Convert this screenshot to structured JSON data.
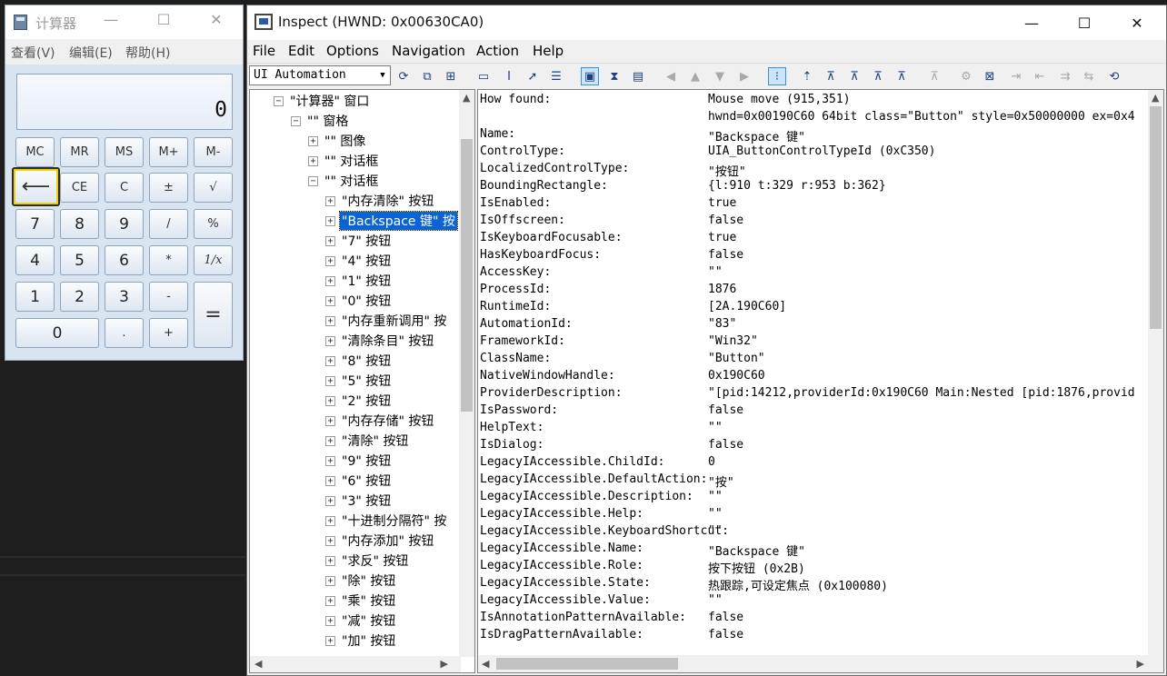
{
  "calc": {
    "title": "计算器",
    "min": "—",
    "max": "☐",
    "close": "✕",
    "menu": [
      "查看(V)",
      "编辑(E)",
      "帮助(H)"
    ],
    "display": "0",
    "buttons": [
      "MC",
      "MR",
      "MS",
      "M+",
      "M-",
      "⟵",
      "CE",
      "C",
      "±",
      "√",
      "7",
      "8",
      "9",
      "/",
      "%",
      "4",
      "5",
      "6",
      "*",
      "1/x",
      "1",
      "2",
      "3",
      "-",
      "=",
      "0",
      ".",
      "+"
    ]
  },
  "inspect": {
    "title": "Inspect  (HWND: 0x00630CA0)",
    "min": "—",
    "max": "☐",
    "close": "✕",
    "menu": [
      "File",
      "Edit",
      "Options",
      "Navigation",
      "Action",
      "Help"
    ],
    "tree_mode": "UI Automation",
    "tree": [
      "\"计算器\" 窗口",
      "\"\" 窗格",
      "\"\" 图像",
      "\"\" 对话框",
      "\"\" 对话框",
      "\"内存清除\" 按钮",
      "\"Backspace 键\" 按",
      "\"7\" 按钮",
      "\"4\" 按钮",
      "\"1\" 按钮",
      "\"0\" 按钮",
      "\"内存重新调用\" 按",
      "\"清除条目\" 按钮",
      "\"8\" 按钮",
      "\"5\" 按钮",
      "\"2\" 按钮",
      "\"内存存储\" 按钮",
      "\"清除\" 按钮",
      "\"9\" 按钮",
      "\"6\" 按钮",
      "\"3\" 按钮",
      "\"十进制分隔符\" 按",
      "\"内存添加\" 按钮",
      "\"求反\" 按钮",
      "\"除\" 按钮",
      "\"乘\" 按钮",
      "\"减\" 按钮",
      "\"加\" 按钮"
    ],
    "properties": [
      {
        "k": "How found:",
        "v": "Mouse move (915,351)"
      },
      {
        "k": "",
        "v": "hwnd=0x00190C60 64bit class=\"Button\" style=0x50000000 ex=0x4"
      },
      {
        "k": "Name:",
        "v": "\"Backspace 键\""
      },
      {
        "k": "ControlType:",
        "v": "UIA_ButtonControlTypeId (0xC350)"
      },
      {
        "k": "LocalizedControlType:",
        "v": "\"按钮\""
      },
      {
        "k": "BoundingRectangle:",
        "v": "{l:910 t:329 r:953 b:362}"
      },
      {
        "k": "IsEnabled:",
        "v": "true"
      },
      {
        "k": "IsOffscreen:",
        "v": "false"
      },
      {
        "k": "IsKeyboardFocusable:",
        "v": "true"
      },
      {
        "k": "HasKeyboardFocus:",
        "v": "false"
      },
      {
        "k": "AccessKey:",
        "v": "\"\""
      },
      {
        "k": "ProcessId:",
        "v": "1876"
      },
      {
        "k": "RuntimeId:",
        "v": "[2A.190C60]"
      },
      {
        "k": "AutomationId:",
        "v": "\"83\""
      },
      {
        "k": "FrameworkId:",
        "v": "\"Win32\""
      },
      {
        "k": "ClassName:",
        "v": "\"Button\""
      },
      {
        "k": "NativeWindowHandle:",
        "v": "0x190C60"
      },
      {
        "k": "ProviderDescription:",
        "v": "\"[pid:14212,providerId:0x190C60 Main:Nested [pid:1876,provid"
      },
      {
        "k": "IsPassword:",
        "v": "false"
      },
      {
        "k": "HelpText:",
        "v": "\"\""
      },
      {
        "k": "IsDialog:",
        "v": "false"
      },
      {
        "k": "LegacyIAccessible.ChildId:",
        "v": "0"
      },
      {
        "k": "LegacyIAccessible.DefaultAction:",
        "v": "    \"按\""
      },
      {
        "k": "LegacyIAccessible.Description:",
        "v": "\"\""
      },
      {
        "k": "LegacyIAccessible.Help:",
        "v": "\"\""
      },
      {
        "k": "LegacyIAccessible.KeyboardShortcut:",
        "v": "   \"\""
      },
      {
        "k": "LegacyIAccessible.Name:",
        "v": "\"Backspace 键\""
      },
      {
        "k": "LegacyIAccessible.Role:",
        "v": "按下按钮 (0x2B)"
      },
      {
        "k": "LegacyIAccessible.State:",
        "v": "热跟踪,可设定焦点 (0x100080)"
      },
      {
        "k": "LegacyIAccessible.Value:",
        "v": "\"\""
      },
      {
        "k": "IsAnnotationPatternAvailable:",
        "v": "false"
      },
      {
        "k": "IsDragPatternAvailable:",
        "v": "false"
      }
    ]
  }
}
